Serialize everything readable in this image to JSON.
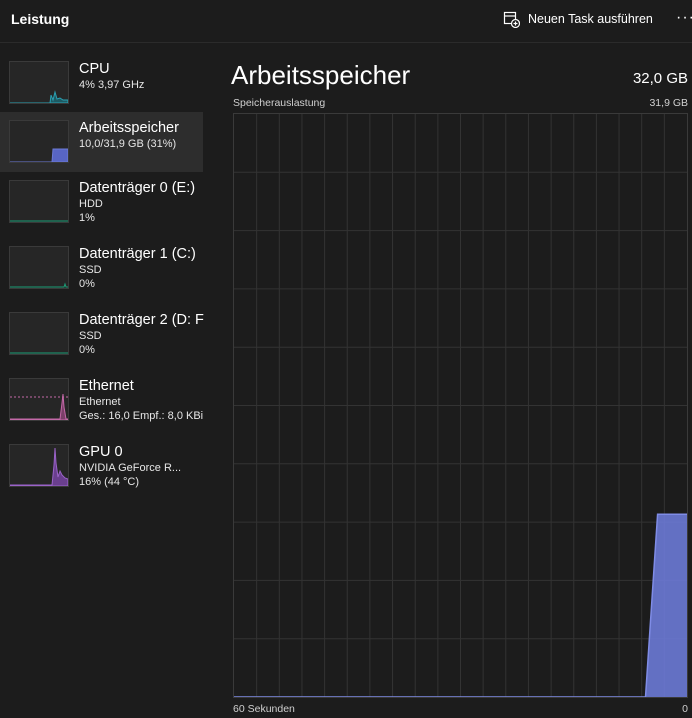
{
  "header": {
    "title": "Leistung",
    "run_task_label": "Neuen Task ausführen",
    "more_label": "···"
  },
  "sidebar": {
    "items": [
      {
        "title": "CPU",
        "line1": "4% 3,97 GHz",
        "line2": "",
        "color": "#2aa1b3",
        "selected": false
      },
      {
        "title": "Arbeitsspeicher",
        "line1": "10,0/31,9 GB (31%)",
        "line2": "",
        "color": "#6c7ad6",
        "selected": true
      },
      {
        "title": "Datenträger 0 (E:)",
        "line1": "HDD",
        "line2": "1%",
        "color": "#1b9e77",
        "selected": false
      },
      {
        "title": "Datenträger 1 (C:)",
        "line1": "SSD",
        "line2": "0%",
        "color": "#1b9e77",
        "selected": false
      },
      {
        "title": "Datenträger 2 (D: F",
        "line1": "SSD",
        "line2": "0%",
        "color": "#1b9e77",
        "selected": false
      },
      {
        "title": "Ethernet",
        "line1": "Ethernet",
        "line2": "Ges.: 16,0 Empf.: 8,0 KBi",
        "color": "#c469a8",
        "selected": false
      },
      {
        "title": "GPU 0",
        "line1": "NVIDIA GeForce R...",
        "line2": "16% (44 °C)",
        "color": "#9b63c9",
        "selected": false
      }
    ]
  },
  "main": {
    "title": "Arbeitsspeicher",
    "total": "32,0 GB",
    "usage_label": "Speicherauslastung",
    "usage_max": "31,9 GB",
    "x_left": "60 Sekunden",
    "x_right": "0"
  },
  "chart_data": {
    "type": "area",
    "accent": "#6c7ad6",
    "x_range": [
      60,
      0
    ],
    "ylim": [
      0,
      31.9
    ],
    "grid": true,
    "x": [
      60,
      5.5,
      3.9,
      0
    ],
    "values": [
      0,
      0,
      10.0,
      10.0
    ]
  }
}
